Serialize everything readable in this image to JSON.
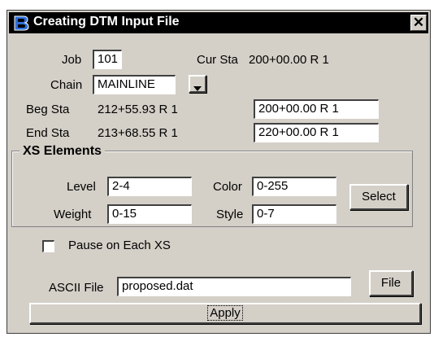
{
  "window": {
    "title": "Creating DTM Input File",
    "close_glyph": "✕"
  },
  "job": {
    "label": "Job",
    "value": "101"
  },
  "cur_sta": {
    "label": "Cur Sta",
    "value": "200+00.00 R 1"
  },
  "chain": {
    "label": "Chain",
    "value": "MAINLINE"
  },
  "beg_sta": {
    "label": "Beg Sta",
    "value": "212+55.93 R 1",
    "input": "200+00.00 R 1"
  },
  "end_sta": {
    "label": "End Sta",
    "value": "213+68.55 R 1",
    "input": "220+00.00 R 1"
  },
  "xs_elements": {
    "title": "XS Elements",
    "level": {
      "label": "Level",
      "value": "2-4"
    },
    "color": {
      "label": "Color",
      "value": "0-255"
    },
    "weight": {
      "label": "Weight",
      "value": "0-15"
    },
    "style": {
      "label": "Style",
      "value": "0-7"
    },
    "select_label": "Select"
  },
  "pause": {
    "label": "Pause on Each XS",
    "checked": false
  },
  "ascii": {
    "label": "ASCII File",
    "value": "proposed.dat",
    "file_button": "File"
  },
  "apply_label": "Apply",
  "icons": {
    "app": "bentley-b-icon",
    "dropdown": "chevron-down-icon",
    "close": "close-icon"
  }
}
